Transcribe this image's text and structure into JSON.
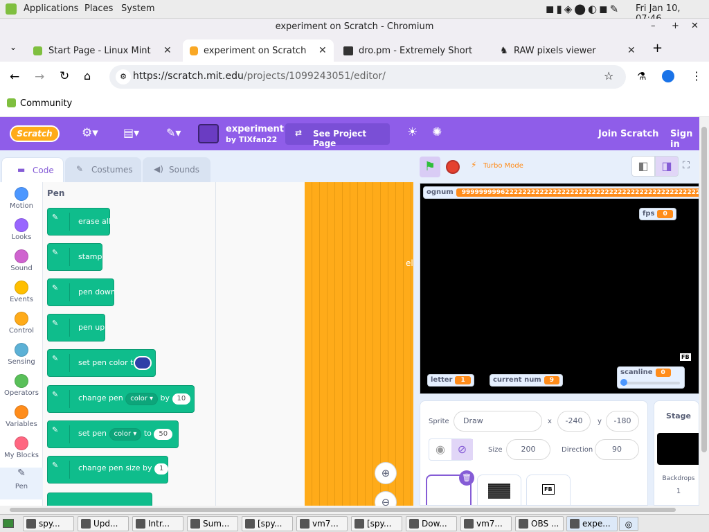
{
  "os": {
    "menus": [
      "Applications",
      "Places",
      "System"
    ],
    "clock": "Fri Jan 10, 07:46"
  },
  "window": {
    "title": "experiment on Scratch - Chromium"
  },
  "tabs": [
    {
      "label": "Start Page - Linux Mint"
    },
    {
      "label": "experiment on Scratch"
    },
    {
      "label": "dro.pm - Extremely Short"
    },
    {
      "label": "RAW pixels viewer"
    }
  ],
  "address": {
    "url_host": "https://scratch.mit.edu",
    "url_path": "/projects/1099243051/editor/"
  },
  "bookmarks": [
    {
      "label": "Community"
    }
  ],
  "scratch": {
    "logo": "Scratch",
    "project_title": "experiment",
    "author": "by TIXfan22",
    "see_project": "See Project Page",
    "join": "Join Scratch",
    "signin": "Sign in",
    "tabs": {
      "code": "Code",
      "costumes": "Costumes",
      "sounds": "Sounds"
    },
    "turbo": "Turbo Mode",
    "categories": [
      {
        "label": "Motion",
        "color": "#4c97ff"
      },
      {
        "label": "Looks",
        "color": "#9966ff"
      },
      {
        "label": "Sound",
        "color": "#cf63cf"
      },
      {
        "label": "Events",
        "color": "#ffbf00"
      },
      {
        "label": "Control",
        "color": "#ffab19"
      },
      {
        "label": "Sensing",
        "color": "#5cb1d6"
      },
      {
        "label": "Operators",
        "color": "#59c059"
      },
      {
        "label": "Variables",
        "color": "#ff8c1a"
      },
      {
        "label": "My Blocks",
        "color": "#ff6680"
      },
      {
        "label": "Pen",
        "color": "#0fbd8c"
      }
    ],
    "palette_heading": "Pen",
    "blocks": {
      "erase_all": "erase all",
      "stamp": "stamp",
      "pen_down": "pen down",
      "pen_up": "pen up",
      "set_pen_color_to": "set pen color to",
      "change_pen": "change pen",
      "change_pen_param": "color",
      "by": "by",
      "change_pen_value": "10",
      "set_pen": "set pen",
      "set_pen_param": "color",
      "to": "to",
      "set_pen_value": "50",
      "change_pen_size_by": "change pen size by",
      "change_pen_size_value": "1"
    },
    "script_fragment": "el",
    "monitors": {
      "ognum_label": "ognum",
      "ognum_value": "9999999996222222222222222222222222222222222222222222222222222",
      "fps_label": "fps",
      "fps_value": "0",
      "letter_label": "letter",
      "letter_value": "1",
      "current_num_label": "current num",
      "current_num_value": "9",
      "scanline_label": "scanline",
      "scanline_value": "0",
      "fb_badge": "FB"
    },
    "sprite_info": {
      "sprite_label": "Sprite",
      "sprite_name": "Draw",
      "x_label": "x",
      "x_value": "-240",
      "y_label": "y",
      "y_value": "-180",
      "size_label": "Size",
      "size_value": "200",
      "direction_label": "Direction",
      "direction_value": "90"
    },
    "stage_panel": {
      "title": "Stage",
      "backdrops_label": "Backdrops",
      "backdrops_count": "1"
    },
    "sprite_thumb_fb": "FB"
  },
  "taskbar": [
    {
      "label": "spy..."
    },
    {
      "label": "Upd..."
    },
    {
      "label": "Intr..."
    },
    {
      "label": "Sum..."
    },
    {
      "label": "[spy..."
    },
    {
      "label": "vm7..."
    },
    {
      "label": "[spy..."
    },
    {
      "label": "Dow..."
    },
    {
      "label": "vm7..."
    },
    {
      "label": "OBS ..."
    },
    {
      "label": "expe..."
    }
  ]
}
